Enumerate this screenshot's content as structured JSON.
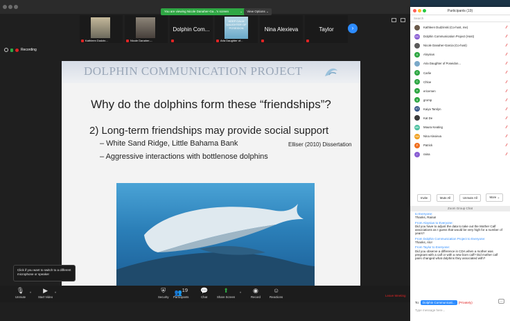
{
  "top_bar": {
    "share_notice": "You are viewing Nicole Danaher-Ga...'s screen",
    "view_options": "View Options ⌄"
  },
  "gallery": {
    "tiles": [
      {
        "name": "Kathleen Dudzin..."
      },
      {
        "name": "Nicole Danaher-..."
      },
      {
        "name": "Dolphin Com..."
      },
      {
        "name": "Aria Daughter of...",
        "thumb_text": "KEEP CALM DAUGHTER OF POSEIDON"
      },
      {
        "name": "Nina Alexieva"
      },
      {
        "name": "Taylor"
      }
    ]
  },
  "recording": {
    "label": "Recording"
  },
  "slide": {
    "brand": "DOLPHIN COMMUNICATION PROJECT",
    "question": "Why do the dolphins form these “friendships”?",
    "point": "2) Long-term friendships may provide social support",
    "bullet1": "– White Sand Ridge, Little Bahama Bank",
    "bullet1_citation": "Elliser (2010) Dissertation",
    "bullet2": "– Aggressive interactions with bottlenose dolphins"
  },
  "tooltip": {
    "text": "Click if you want to switch to a different microphone or speaker"
  },
  "toolbar": {
    "unmute": "Unmute",
    "start_video": "Start Video",
    "security": "Security",
    "participants": "Participants",
    "participants_count": "19",
    "chat": "Chat",
    "share_screen": "Share Screen",
    "record": "Record",
    "reactions": "Reactions",
    "leave": "Leave Meeting"
  },
  "participants": {
    "title": "Participants (19)",
    "search_placeholder": "Search",
    "list": [
      {
        "name": "Kathleen Dudzinski (Co-host, me)",
        "initials": "",
        "color": "#6a5a4a"
      },
      {
        "name": "Dolphin Communication Project (Host)",
        "initials": "DC",
        "color": "#8a5fd3"
      },
      {
        "name": "Nicole Danaher-Garcia (Co-host)",
        "initials": "",
        "color": "#5a5a5a"
      },
      {
        "name": "Aloysius",
        "initials": "A",
        "color": "#2fa744"
      },
      {
        "name": "Aria Daughter of Poseidon...",
        "initials": "",
        "color": "#7aa9c9"
      },
      {
        "name": "Carlie",
        "initials": "C",
        "color": "#2fa744"
      },
      {
        "name": "Chloe",
        "initials": "C",
        "color": "#2fa744"
      },
      {
        "name": "ericemen",
        "initials": "e",
        "color": "#2fa744"
      },
      {
        "name": "gromp",
        "initials": "g",
        "color": "#2fa744"
      },
      {
        "name": "Kaiya Tamlyn",
        "initials": "KT",
        "color": "#3b5a8a"
      },
      {
        "name": "Kat De",
        "initials": "",
        "color": "#3a3a3a"
      },
      {
        "name": "Maura Keating",
        "initials": "MK",
        "color": "#4cc0a0"
      },
      {
        "name": "Nina Alexieva",
        "initials": "NA",
        "color": "#f0a020"
      },
      {
        "name": "Patrick",
        "initials": "P",
        "color": "#f07020"
      },
      {
        "name": "raina",
        "initials": "r",
        "color": "#8a5fd3"
      }
    ],
    "invite": "Invite",
    "mute_all": "Mute All",
    "unmute_all": "Unmute All",
    "more": "More ⌄"
  },
  "chat": {
    "title": "Zoom Group Chat",
    "messages": [
      {
        "from": "to Everyone:",
        "text": "Thanks, Raina!"
      },
      {
        "from": "From Aloysius to Everyone:",
        "text": "Did you have to adjust the data to take out the Mother Calf associations as I guess that would be very high for a number of years?"
      },
      {
        "from": "From Dolphin Communication Project to Everyone:",
        "text": "Thanks, Alo!"
      },
      {
        "from": "From Taylor to Everyone:",
        "text": "Did you observe a difference in CDA when a mother was pregnant with a calf or with a new born calf? Did mother calf pairs changed what dolphins they associated with?"
      }
    ],
    "to_label": "To:",
    "recipient": "Dolphin Communicati...",
    "privately": "(Privately)",
    "input_placeholder": "Type message here..."
  }
}
